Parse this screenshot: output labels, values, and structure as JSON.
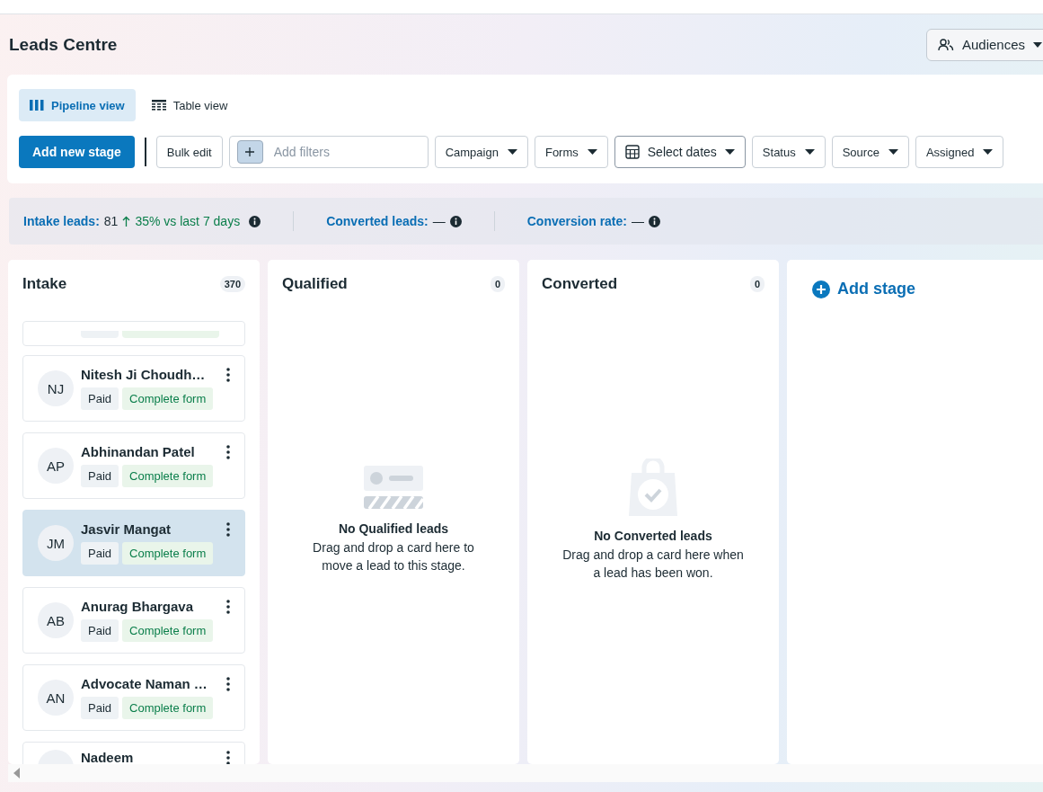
{
  "header": {
    "title": "Leads Centre",
    "audiences_button": "Audiences"
  },
  "view_tabs": [
    {
      "label": "Pipeline view",
      "kind": "pipeline",
      "selected": true
    },
    {
      "label": "Table view",
      "kind": "table",
      "selected": false
    }
  ],
  "toolbar": {
    "add_stage_button": "Add new stage",
    "bulk_edit_button": "Bulk edit",
    "filter_placeholder": "Add filters",
    "dropdowns": [
      {
        "label": "Campaign",
        "kind": "plain"
      },
      {
        "label": "Forms",
        "kind": "plain"
      },
      {
        "label": "Select dates",
        "kind": "date"
      },
      {
        "label": "Status",
        "kind": "plain"
      },
      {
        "label": "Source",
        "kind": "plain"
      },
      {
        "label": "Assigned",
        "kind": "cut"
      }
    ]
  },
  "stats": [
    {
      "label": "Intake leads:",
      "value": "81",
      "change": "35% vs last 7 days"
    },
    {
      "label": "Converted leads:",
      "value": "—"
    },
    {
      "label": "Conversion rate:",
      "value": "—"
    }
  ],
  "stages": [
    {
      "title": "Intake",
      "count": "370",
      "kind": "list",
      "leads": [
        {
          "initials": "NJ",
          "name": "Nitesh Ji Choudh…",
          "tags": [
            "Paid",
            "Complete form"
          ],
          "selected": false
        },
        {
          "initials": "AP",
          "name": "Abhinandan Patel",
          "tags": [
            "Paid",
            "Complete form"
          ],
          "selected": false
        },
        {
          "initials": "JM",
          "name": "Jasvir Mangat",
          "tags": [
            "Paid",
            "Complete form"
          ],
          "selected": true
        },
        {
          "initials": "AB",
          "name": "Anurag Bhargava",
          "tags": [
            "Paid",
            "Complete form"
          ],
          "selected": false
        },
        {
          "initials": "AN",
          "name": "Advocate Naman …",
          "tags": [
            "Paid",
            "Complete form"
          ],
          "selected": false
        },
        {
          "name": "Nadeem",
          "selected": false
        }
      ]
    },
    {
      "title": "Qualified",
      "count": "0",
      "kind": "pending",
      "empty_title": "No Qualified leads",
      "empty_text": "Drag and drop a card here to move a lead to this stage."
    },
    {
      "title": "Converted",
      "count": "0",
      "kind": "won",
      "empty_title": "No Converted leads",
      "empty_text": "Drag and drop a card here when a lead has been won."
    }
  ],
  "add_stage": "Add stage"
}
